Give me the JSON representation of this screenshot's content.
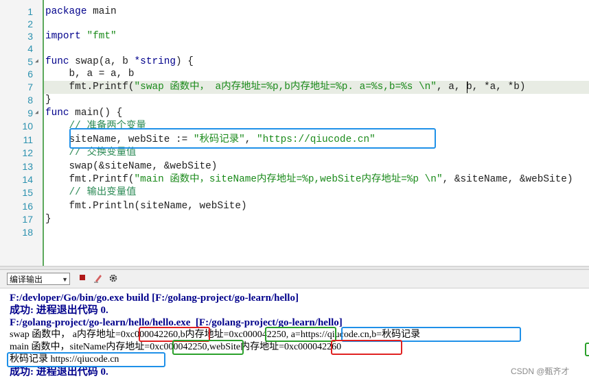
{
  "editor": {
    "line_numbers": [
      "1",
      "2",
      "3",
      "4",
      "5",
      "6",
      "7",
      "8",
      "9",
      "10",
      "11",
      "12",
      "13",
      "14",
      "15",
      "16",
      "17",
      "18"
    ],
    "code": {
      "l1_kw": "package",
      "l1_rest": " main",
      "l3_kw": "import",
      "l3_str": "\"fmt\"",
      "l5_kw": "func",
      "l5_rest": " swap(a, b ",
      "l5_type": "*string",
      "l5_end": ") {",
      "l6": "    b, a = a, b",
      "l7_pre": "    fmt.Printf(",
      "l7_str": "\"swap 函数中， a内存地址=%p,b内存地址=%p. a=%s,b=%s \\n\"",
      "l7_post": ", a, b, *a, *b)",
      "l8": "}",
      "l9_kw": "func",
      "l9_rest": " main() {",
      "l10_cmt": "    // 准备两个变量",
      "l11_pre": "    siteName, webSite := ",
      "l11_s1": "\"秋码记录\"",
      "l11_mid": ", ",
      "l11_s2": "\"https://qiucode.cn\"",
      "l12_cmt": "    // 交换变量值",
      "l13": "    swap(&siteName, &webSite)",
      "l14_pre": "    fmt.Printf(",
      "l14_str": "\"main 函数中，siteName内存地址=%p,webSite内存地址=%p \\n\"",
      "l14_post": ", &siteName, &webSite)",
      "l15_cmt": "    // 输出变量值",
      "l16": "    fmt.Println(siteName, webSite)",
      "l17": "}"
    }
  },
  "toolbar": {
    "output_select": "编译输出",
    "stop_icon": "stop-icon",
    "clear_icon": "clear-icon",
    "settings_icon": "gear-icon"
  },
  "output": {
    "line1": "F:/devloper/Go/bin/go.exe build [F:/golang-project/go-learn/hello]",
    "line2": "成功: 进程退出代码 0.",
    "line3": "F:/golang-project/go-learn/hello/hello.exe  [F:/golang-project/go-learn/hello]",
    "line4": "swap 函数中， a内存地址=0xc000042260,b内存地址=0xc000042250, a=https://qiucode.cn,b=秋码记录",
    "line5": "main 函数中，siteName内存地址=0xc000042250,webSite内存地址=0xc000042260",
    "line6": "秋码记录 https://qiucode.cn",
    "line7": "成功: 进程退出代码 0."
  },
  "watermark": "CSDN @甄齐才",
  "colors": {
    "box_blue": "#1e90e8",
    "box_red": "#e02020",
    "box_green": "#2aa02a",
    "keyword": "#00008b",
    "string": "#1a8a1a"
  }
}
